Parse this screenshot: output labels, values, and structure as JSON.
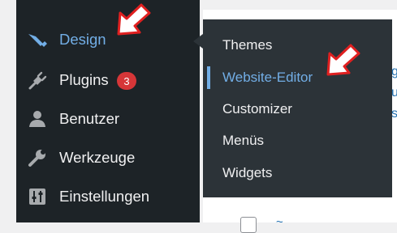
{
  "sidebar": {
    "items": [
      {
        "label": "Design",
        "icon": "paintbrush-icon",
        "active": true
      },
      {
        "label": "Plugins",
        "icon": "plug-icon",
        "badge": "3"
      },
      {
        "label": "Benutzer",
        "icon": "user-icon"
      },
      {
        "label": "Werkzeuge",
        "icon": "wrench-icon"
      },
      {
        "label": "Einstellungen",
        "icon": "settings-sliders-icon"
      }
    ]
  },
  "submenu": {
    "items": [
      {
        "label": "Themes"
      },
      {
        "label": "Website-Editor",
        "current": true
      },
      {
        "label": "Customizer"
      },
      {
        "label": "Menüs"
      },
      {
        "label": "Widgets"
      }
    ]
  },
  "background": {
    "peek_lines": [
      "g",
      "u",
      "sc"
    ],
    "bottom_link": "~"
  },
  "colors": {
    "sidebar_bg": "#1d2327",
    "submenu_bg": "#2c3338",
    "accent": "#72aee6",
    "badge": "#d63638",
    "annotation_arrow": "#e02020"
  }
}
